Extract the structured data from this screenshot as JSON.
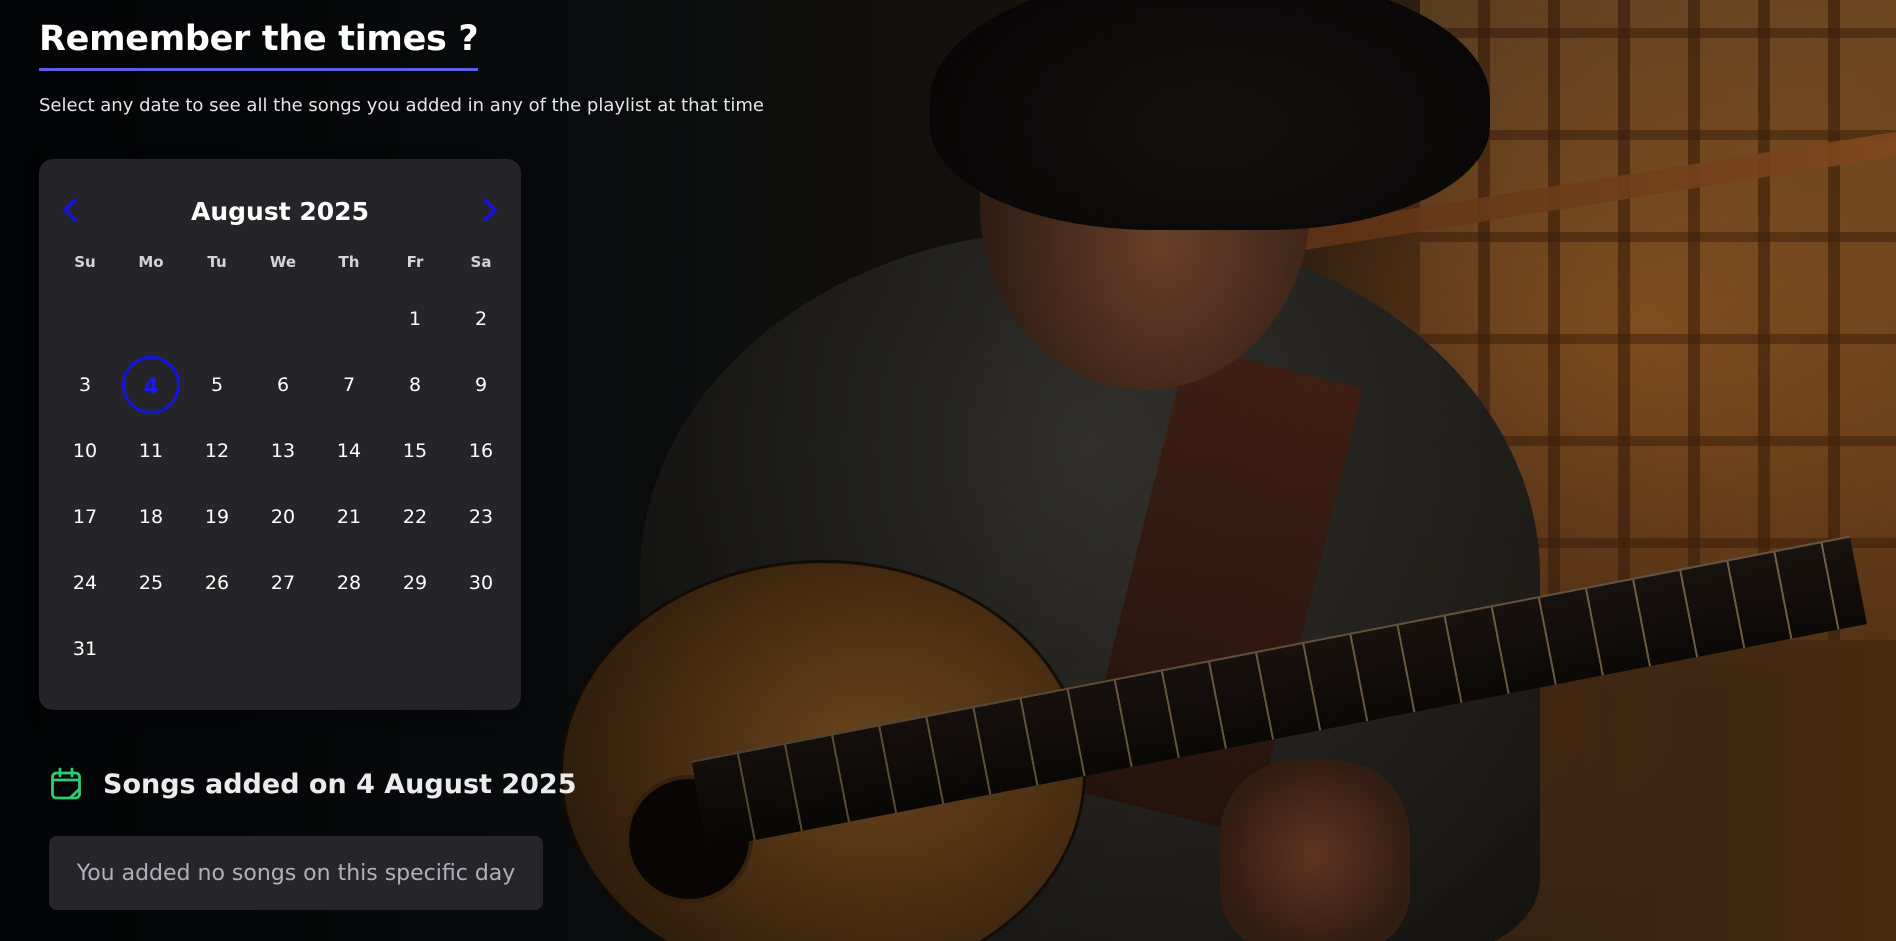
{
  "page": {
    "title": "Remember the times ?",
    "subtitle": "Select any date to see all the songs you added in any of the playlist at that time"
  },
  "calendar": {
    "month_label": "August 2025",
    "prev_icon": "chevron-left-icon",
    "next_icon": "chevron-right-icon",
    "weekdays": [
      "Su",
      "Mo",
      "Tu",
      "We",
      "Th",
      "Fr",
      "Sa"
    ],
    "first_weekday_index": 5,
    "days_in_month": 31,
    "selected_day": 4,
    "days": [
      "1",
      "2",
      "3",
      "4",
      "5",
      "6",
      "7",
      "8",
      "9",
      "10",
      "11",
      "12",
      "13",
      "14",
      "15",
      "16",
      "17",
      "18",
      "19",
      "20",
      "21",
      "22",
      "23",
      "24",
      "25",
      "26",
      "27",
      "28",
      "29",
      "30",
      "31"
    ],
    "selected_color": "#1414e0"
  },
  "songs": {
    "heading_icon": "calendar-icon",
    "heading": "Songs added on 4 August 2025",
    "empty_message": "You added no songs on this specific day",
    "icon_color": "#2ecc71"
  },
  "theme": {
    "accent": "#5b5fe8",
    "panel": "#26262a"
  }
}
